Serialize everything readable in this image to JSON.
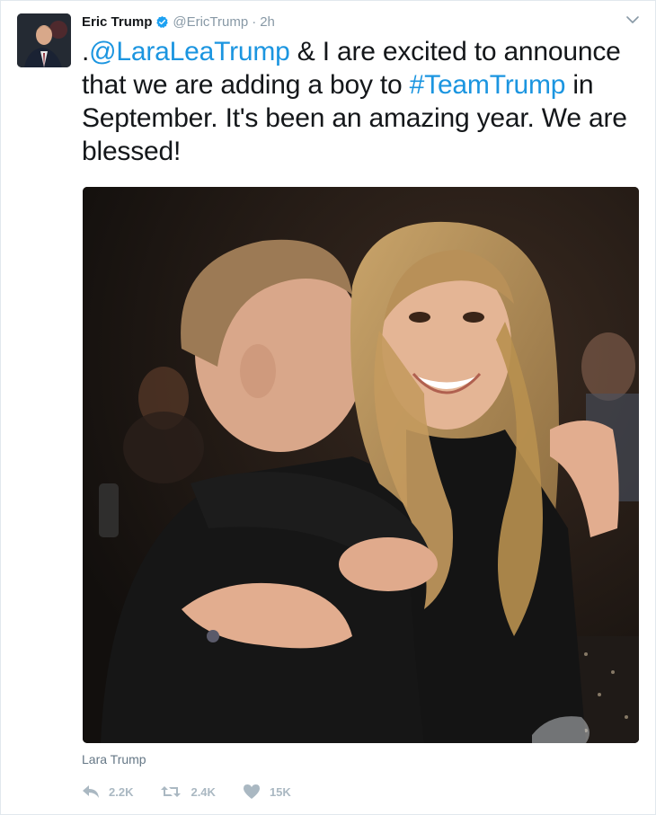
{
  "tweet": {
    "author_name": "Eric Trump",
    "handle": "@EricTrump",
    "separator": "·",
    "time": "2h",
    "text_before_mention": ".",
    "mention": "@LaraLeaTrump",
    "text_mid": " & I are excited to announce that we are adding a boy to ",
    "hashtag": "#TeamTrump",
    "text_after": " in September. It's been an amazing year. We are blessed!",
    "tagged_user": "Lara Trump",
    "colors": {
      "link": "#1b95e0",
      "verified": "#1da1f2",
      "muted": "#8899a6",
      "action_icon": "#aab8c2"
    }
  },
  "actions": {
    "reply": {
      "icon": "reply-icon",
      "count": "2.2K"
    },
    "retweet": {
      "icon": "retweet-icon",
      "count": "2.4K"
    },
    "like": {
      "icon": "heart-icon",
      "count": "15K"
    }
  },
  "icons": {
    "verified": "verified-badge-icon",
    "menu": "chevron-down-icon"
  }
}
